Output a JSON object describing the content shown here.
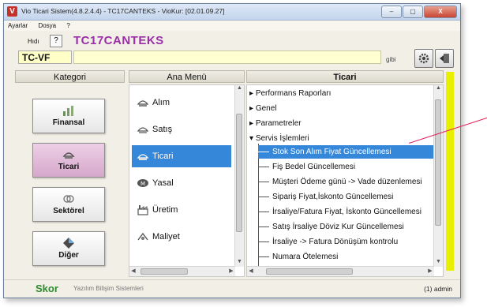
{
  "window": {
    "title": "Vio Ticari Sistem(4.8.2.4.4) - TC17CANTEKS - VioKur: [02.01.09.27]",
    "app_icon_letter": "V",
    "controls": [
      "–",
      "▢",
      "X"
    ]
  },
  "menubar": [
    "Ayarlar",
    "Dosya",
    "?"
  ],
  "header": {
    "hidi_label": "Hıdı",
    "help_label": "?",
    "company": "TC17CANTEKS",
    "code": "TC-VF",
    "search_value": "",
    "gibi_label": "gibi"
  },
  "columns": {
    "kategori": "Kategori",
    "ana_menu": "Ana Menü",
    "ticari": "Ticari"
  },
  "categories": [
    {
      "label": "Finansal",
      "icon": "finance-icon",
      "active": false
    },
    {
      "label": "Ticari",
      "icon": "commerce-icon",
      "active": true
    },
    {
      "label": "Sektörel",
      "icon": "sector-icon",
      "active": false
    },
    {
      "label": "Diğer",
      "icon": "other-icon",
      "active": false
    }
  ],
  "main_menu": [
    {
      "label": "Alım",
      "icon": "purchase-icon",
      "selected": false
    },
    {
      "label": "Satış",
      "icon": "sales-icon",
      "selected": false
    },
    {
      "label": "Ticari",
      "icon": "commerce-icon",
      "selected": true
    },
    {
      "label": "Yasal",
      "icon": "legal-icon",
      "selected": false
    },
    {
      "label": "Üretim",
      "icon": "production-icon",
      "selected": false
    },
    {
      "label": "Maliyet",
      "icon": "cost-icon",
      "selected": false
    }
  ],
  "tree": {
    "nodes": [
      {
        "label": "Performans Raporları",
        "expanded": false
      },
      {
        "label": "Genel",
        "expanded": false
      },
      {
        "label": "Parametreler",
        "expanded": false
      },
      {
        "label": "Servis İşlemleri",
        "expanded": true
      }
    ],
    "leaves": [
      {
        "label": "Stok Son Alım Fiyat Güncellemesi",
        "selected": true
      },
      {
        "label": "Fiş Bedel Güncellemesi",
        "selected": false
      },
      {
        "label": "Müşteri Ödeme günü -> Vade düzenlemesi",
        "selected": false
      },
      {
        "label": "Sipariş Fiyat,İskonto Güncellemesi",
        "selected": false
      },
      {
        "label": "İrsaliye/Fatura Fiyat, İskonto Güncellemesi",
        "selected": false
      },
      {
        "label": "Satış İrsaliye Döviz Kur Güncellemesi",
        "selected": false
      },
      {
        "label": "İrsaliye -> Fatura Dönüşüm kontrolu",
        "selected": false
      },
      {
        "label": "Numara Ötelemesi",
        "selected": false
      }
    ]
  },
  "status": {
    "logo": "Skor",
    "company_name": "Yazılım Bilişim Sistemleri",
    "user": "(1) admin"
  },
  "colors": {
    "selection": "#3487d9",
    "company": "#9b2ea8",
    "active_category": "#d6a8cb",
    "accent_bar": "#e8f000",
    "pointer": "#e0245a"
  }
}
